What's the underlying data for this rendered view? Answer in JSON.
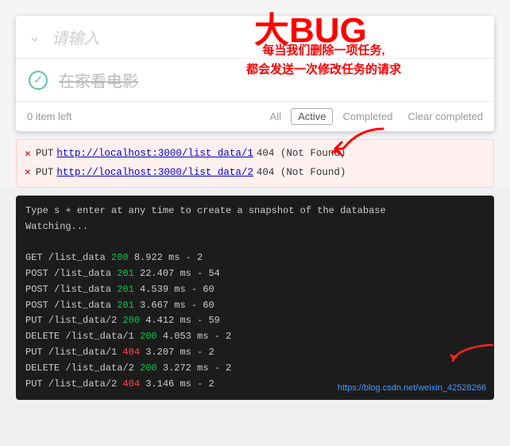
{
  "bigbug": {
    "title": "大BUG",
    "annotation_line1": "每当我们删除一项任务,",
    "annotation_line2": "都会发送一次修改任务的请求"
  },
  "todo": {
    "input_placeholder": "请输入",
    "item_text": "在家看电影",
    "footer": {
      "count": "0 item left",
      "filter_all": "All",
      "filter_active": "Active",
      "filter_completed": "Completed",
      "clear": "Clear completed"
    }
  },
  "errors": [
    {
      "method": "PUT",
      "url": "http://localhost:3000/list_data/1",
      "status": "404 (Not Found)"
    },
    {
      "method": "PUT",
      "url": "http://localhost:3000/list_data/2",
      "status": "404 (Not Found)"
    }
  ],
  "terminal": {
    "lines": [
      {
        "text": "Type s + enter at any time to create a snapshot of the database",
        "color": "white"
      },
      {
        "text": "Watching...",
        "color": "white"
      },
      {
        "text": "",
        "color": "white"
      },
      {
        "text": "GET /list_data ",
        "color": "white",
        "status": "200",
        "rest": " 8.922 ms - 2"
      },
      {
        "text": "POST /list_data ",
        "color": "white",
        "status": "201",
        "rest": " 22.407 ms - 54"
      },
      {
        "text": "POST /list_data ",
        "color": "white",
        "status": "201",
        "rest": " 4.539 ms - 60"
      },
      {
        "text": "POST /list_data ",
        "color": "white",
        "status": "201",
        "rest": " 3.667 ms - 60"
      },
      {
        "text": "PUT /list_data/2 ",
        "color": "white",
        "status": "200",
        "rest": " 4.412 ms - 59"
      },
      {
        "text": "DELETE /list_data/1 ",
        "color": "white",
        "status": "200",
        "rest": " 4.053 ms - 2"
      },
      {
        "text": "PUT /list_data/1 ",
        "color": "white",
        "status": "404",
        "rest": " 3.207 ms - 2"
      },
      {
        "text": "DELETE /list_data/2 ",
        "color": "white",
        "status": "200",
        "rest": " 3.272 ms - 2"
      },
      {
        "text": "PUT /list_data/2 ",
        "color": "white",
        "status": "404",
        "rest": " 3.146 ms - 2"
      }
    ],
    "watermark": "https://blog.csdn.net/weixin_42528266"
  }
}
